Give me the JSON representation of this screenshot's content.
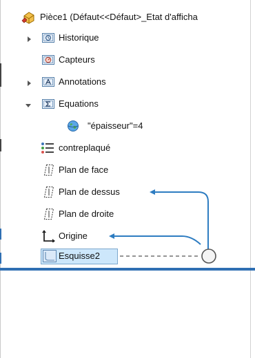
{
  "tree": {
    "root": {
      "label": "Pièce1  (Défaut<<Défaut>_Etat d'afficha",
      "icon": "part-icon"
    },
    "items": [
      {
        "label": "Historique",
        "icon": "history-folder-icon",
        "expanded": false
      },
      {
        "label": "Capteurs",
        "icon": "sensors-folder-icon"
      },
      {
        "label": "Annotations",
        "icon": "annotations-folder-icon",
        "expanded": false
      },
      {
        "label": "Equations",
        "icon": "equations-folder-icon",
        "expanded": true
      },
      {
        "label": "\"épaisseur\"=4",
        "icon": "global-variable-icon"
      },
      {
        "label": "contreplaqué",
        "icon": "material-icon"
      },
      {
        "label": "Plan de face",
        "icon": "plane-icon"
      },
      {
        "label": "Plan de dessus",
        "icon": "plane-icon"
      },
      {
        "label": "Plan de droite",
        "icon": "plane-icon"
      },
      {
        "label": "Origine",
        "icon": "origin-icon"
      },
      {
        "label": "Esquisse2",
        "icon": "sketch-icon",
        "selected": true
      }
    ]
  },
  "colors": {
    "selection_fill": "#cde7fb",
    "selection_border": "#7ca7cd",
    "rollback_bar": "#2f6fb3",
    "relation_arrow": "#2d7cc1",
    "folder_accent": "#4d7aa7"
  }
}
